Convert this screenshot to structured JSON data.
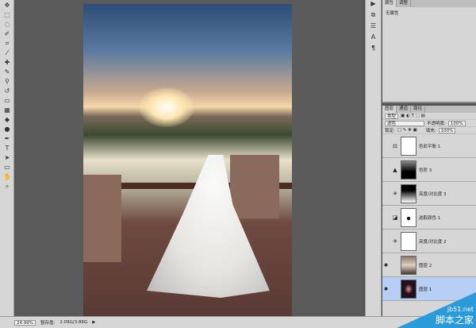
{
  "tools": [
    "move",
    "marquee",
    "lasso",
    "quick-select",
    "crop",
    "eyedropper",
    "healing",
    "brush",
    "stamp",
    "history-brush",
    "eraser",
    "gradient",
    "blur",
    "dodge",
    "pen",
    "type",
    "path-select",
    "shape",
    "hand",
    "zoom"
  ],
  "properties": {
    "tabs": [
      "属性",
      "调整"
    ],
    "label": "无属性"
  },
  "layers_panel": {
    "tabs": [
      "图层",
      "通道",
      "路径"
    ],
    "filter": "类型",
    "blend_mode": "滤色",
    "opacity_label": "不透明度:",
    "opacity": "100%",
    "lock_label": "锁定:",
    "fill_label": "填充:",
    "fill": "100%",
    "layers": [
      {
        "name": "色彩平衡 1",
        "icon": "balance",
        "thumb": "white"
      },
      {
        "name": "色阶 3",
        "icon": "levels",
        "thumb": "dark-gradient"
      },
      {
        "name": "亮度/对比度 3",
        "icon": "sun",
        "thumb": "black-top"
      },
      {
        "name": "选取颜色 1",
        "icon": "selective",
        "thumb": "white-dot"
      },
      {
        "name": "亮度/对比度 2",
        "icon": "sun",
        "thumb": "white"
      },
      {
        "name": "图层 2",
        "icon": "",
        "thumb": "photo"
      },
      {
        "name": "图层 1",
        "icon": "",
        "thumb": "dark",
        "selected": true
      }
    ]
  },
  "status": {
    "zoom": "24.99%",
    "scratch_label": "暂存盘:",
    "scratch": "2.09G/3.86G"
  },
  "watermark": {
    "url": "jb51.net",
    "name": "脚本之家"
  }
}
